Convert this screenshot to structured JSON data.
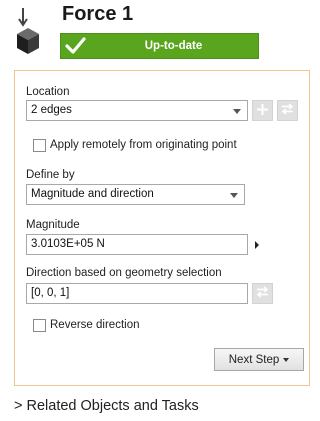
{
  "header": {
    "title": "Force 1",
    "status": "Up-to-date"
  },
  "location": {
    "label": "Location",
    "value": "2 edges"
  },
  "apply_remote": {
    "label": "Apply remotely from originating point",
    "checked": false
  },
  "define_by": {
    "label": "Define by",
    "value": "Magnitude and direction"
  },
  "magnitude": {
    "label": "Magnitude",
    "value": "3.0103E+05 N"
  },
  "direction": {
    "label": "Direction based on geometry selection",
    "value": "[0, 0, 1]"
  },
  "reverse": {
    "label": "Reverse direction",
    "checked": false
  },
  "next_step": {
    "label": "Next Step"
  },
  "related": {
    "label": "> Related Objects and Tasks"
  },
  "colors": {
    "status_green": "#5aa51e",
    "panel_border": "#f2c58a",
    "disabled_button": "#e0e0e0"
  },
  "icons": [
    "force-feature-icon",
    "checkmark-icon",
    "dropdown-arrow-icon",
    "plus-icon",
    "swap-icon",
    "flyout-arrow-icon",
    "caret-down-icon"
  ]
}
